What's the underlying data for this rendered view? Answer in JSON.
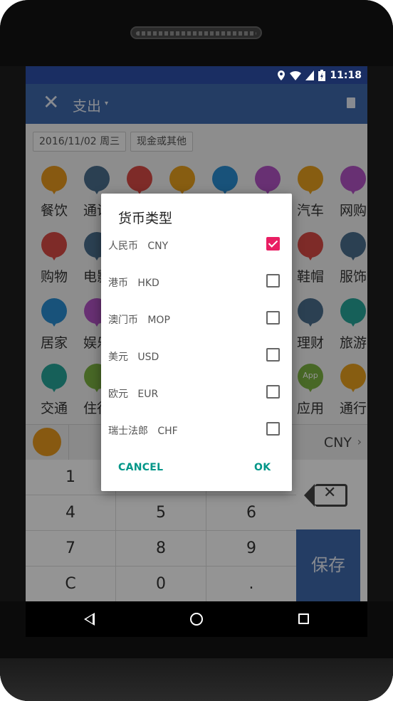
{
  "status_bar": {
    "time": "11:18"
  },
  "app_bar": {
    "close_glyph": "✕",
    "title": "支出",
    "caret": "▾"
  },
  "date_chip": "2016/11/02 周三",
  "payment_chip": "现金或其他",
  "categories": [
    {
      "label": "餐饮",
      "color": "#e89a1e",
      "icon": "bowl-icon"
    },
    {
      "label": "通讯",
      "color": "#4b6e8e",
      "icon": "phone-icon"
    },
    {
      "label": "",
      "color": "#d94a45",
      "icon": "clock-icon"
    },
    {
      "label": "",
      "color": "#e8a11e",
      "icon": "ticket-icon"
    },
    {
      "label": "",
      "color": "#2a8ed3",
      "icon": "apple-icon"
    },
    {
      "label": "",
      "color": "#b353c6",
      "icon": "bottle-icon"
    },
    {
      "label": "汽车",
      "color": "#e8a11e",
      "icon": "car-icon"
    },
    {
      "label": "网购",
      "color": "#b353c6",
      "icon": "buy-icon"
    },
    {
      "label": "购物",
      "color": "#d94a45",
      "icon": "cart-icon"
    },
    {
      "label": "电影",
      "color": "#4b6e8e",
      "icon": "film-icon"
    },
    {
      "label": "鞋帽",
      "color": "#d94a45",
      "icon": "shoe-icon"
    },
    {
      "label": "服饰",
      "color": "#4b6e8e",
      "icon": "shirt-icon"
    },
    {
      "label": "居家",
      "color": "#2a8ed3",
      "icon": "sofa-icon"
    },
    {
      "label": "娱乐",
      "color": "#b353c6",
      "icon": "mic-icon"
    },
    {
      "label": "理财",
      "color": "#4b6e8e",
      "icon": "piggy-icon"
    },
    {
      "label": "旅游",
      "color": "#26a69a",
      "icon": "travel-icon"
    },
    {
      "label": "交通",
      "color": "#26a69a",
      "icon": "bus-icon"
    },
    {
      "label": "住行",
      "color": "#7cb342",
      "icon": "home-icon"
    },
    {
      "label": "应用",
      "color": "#7cb342",
      "icon": "app-icon",
      "badge": "App"
    },
    {
      "label": "通行",
      "color": "#e8a11e",
      "icon": "card-icon"
    }
  ],
  "currency_display": "CNY",
  "keypad": [
    "1",
    "",
    "",
    "4",
    "5",
    "6",
    "7",
    "8",
    "9",
    "C",
    "0",
    "."
  ],
  "save_label": "保存",
  "dialog": {
    "title": "货币类型",
    "options": [
      {
        "label": "人民币   CNY",
        "checked": true
      },
      {
        "label": "港币   HKD",
        "checked": false
      },
      {
        "label": "澳门币   MOP",
        "checked": false
      },
      {
        "label": "美元   USD",
        "checked": false
      },
      {
        "label": "欧元   EUR",
        "checked": false
      },
      {
        "label": "瑞士法郎   CHF",
        "checked": false
      }
    ],
    "cancel_label": "CANCEL",
    "ok_label": "OK"
  },
  "colors": {
    "appbar": "#3f69ad",
    "statusbar": "#1a2e63",
    "accent_checkbox": "#e91e63",
    "dialog_button": "#009688"
  }
}
